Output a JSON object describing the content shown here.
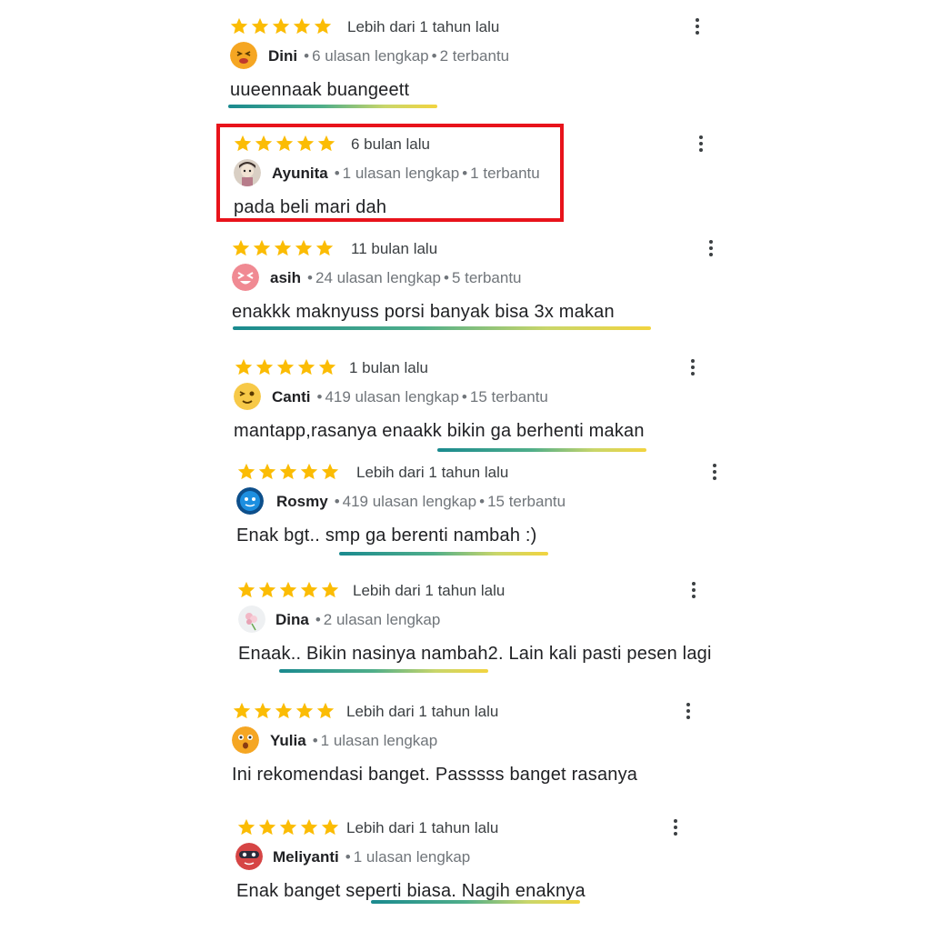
{
  "colors": {
    "star": "#fbbc04",
    "highlight": "#e8131b",
    "name": "#202124",
    "meta": "#70757a"
  },
  "reviews": [
    {
      "rating": 5,
      "date": "Lebih dari 1 tahun lalu",
      "author": "Dini",
      "reviews_count": "6 ulasan lengkap",
      "helpful": "2 terbantu",
      "text": "uueennaak buangeett",
      "avatar_icon": "smiling-face-avatar-icon"
    },
    {
      "rating": 5,
      "date": "6 bulan lalu",
      "author": "Ayunita",
      "reviews_count": "1 ulasan lengkap",
      "helpful": "1 terbantu",
      "text": "pada beli mari dah",
      "avatar_icon": "photo-avatar-icon",
      "highlighted": true
    },
    {
      "rating": 5,
      "date": "11 bulan lalu",
      "author": "asih",
      "reviews_count": "24 ulasan lengkap",
      "helpful": "5 terbantu",
      "text": "enakkk maknyuss porsi banyak bisa 3x makan",
      "avatar_icon": "laughing-face-avatar-icon"
    },
    {
      "rating": 5,
      "date": "1 bulan lalu",
      "author": "Canti",
      "reviews_count": "419 ulasan lengkap",
      "helpful": "15 terbantu",
      "text": "mantapp,rasanya enaakk bikin ga berhenti makan",
      "avatar_icon": "winking-face-avatar-icon"
    },
    {
      "rating": 5,
      "date": "Lebih dari 1 tahun lalu",
      "author": "Rosmy",
      "reviews_count": "419 ulasan lengkap",
      "helpful": "15 terbantu",
      "text": "Enak bgt.. smp ga berenti nambah :)",
      "avatar_icon": "blue-face-avatar-icon"
    },
    {
      "rating": 5,
      "date": "Lebih dari 1 tahun lalu",
      "author": "Dina",
      "reviews_count": "2 ulasan lengkap",
      "helpful": "",
      "text": "Enaak.. Bikin nasinya nambah2. Lain kali pasti pesen lagi",
      "avatar_icon": "flower-avatar-icon"
    },
    {
      "rating": 5,
      "date": "Lebih dari 1 tahun lalu",
      "author": "Yulia",
      "reviews_count": "1 ulasan lengkap",
      "helpful": "",
      "text": "Ini rekomendasi banget. Passsss banget rasanya",
      "avatar_icon": "surprised-face-avatar-icon"
    },
    {
      "rating": 5,
      "date": "Lebih dari 1 tahun lalu",
      "author": "Meliyanti",
      "reviews_count": "1 ulasan lengkap",
      "helpful": "",
      "text": "Enak banget seperti biasa. Nagih enaknya",
      "avatar_icon": "masked-face-avatar-icon"
    }
  ]
}
